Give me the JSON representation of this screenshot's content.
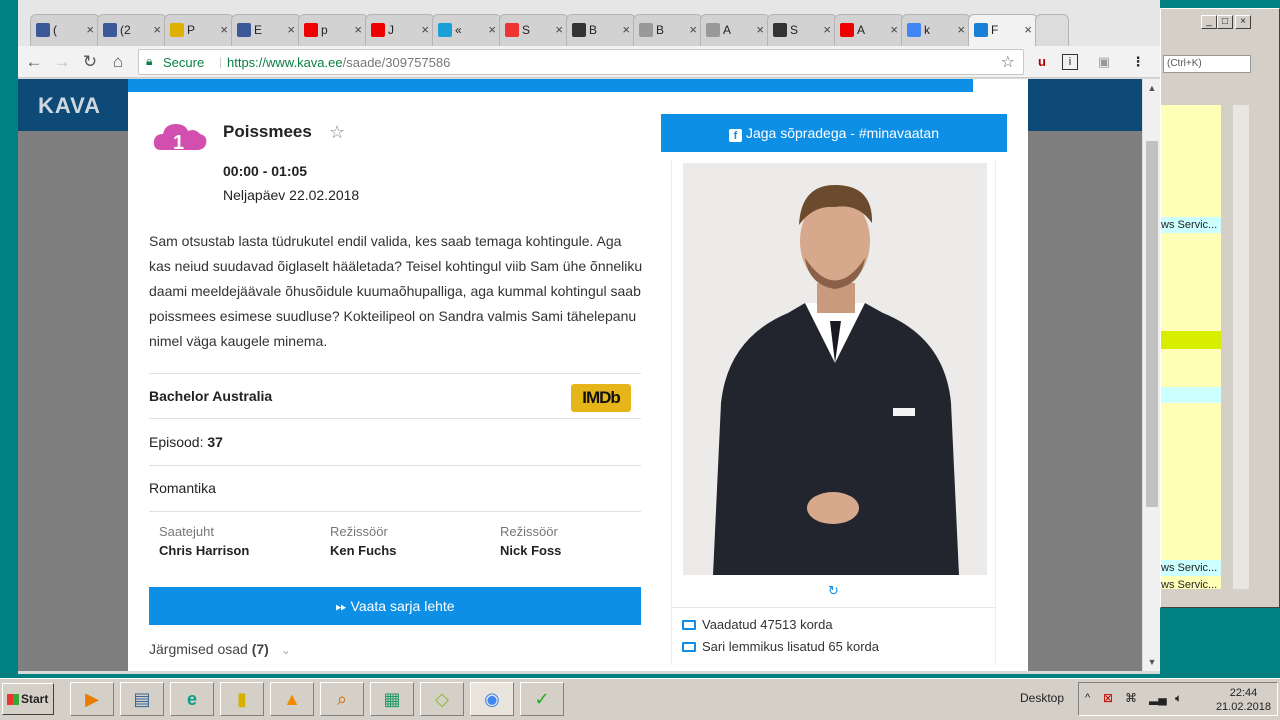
{
  "browser": {
    "tabs": [
      {
        "favicon": "facebook-icon",
        "label": "(",
        "color": "#3b5998"
      },
      {
        "favicon": "facebook-icon",
        "label": "(2",
        "color": "#3b5998"
      },
      {
        "favicon": "sun-icon",
        "label": "P",
        "color": "#e0b000"
      },
      {
        "favicon": "facebook-icon",
        "label": "E",
        "color": "#3b5998"
      },
      {
        "favicon": "youtube-icon",
        "label": "p",
        "color": "#e00"
      },
      {
        "favicon": "youtube-icon",
        "label": "J",
        "color": "#e00"
      },
      {
        "favicon": "pm-icon",
        "label": "«",
        "color": "#1ca0d8"
      },
      {
        "favicon": "star-icon",
        "label": "S",
        "color": "#e33"
      },
      {
        "favicon": "tv-icon",
        "label": "B",
        "color": "#333"
      },
      {
        "favicon": "document-icon",
        "label": "B",
        "color": "#999"
      },
      {
        "favicon": "document-icon",
        "label": "A",
        "color": "#999"
      },
      {
        "favicon": "tv-icon",
        "label": "S",
        "color": "#333"
      },
      {
        "favicon": "youtube-icon",
        "label": "A",
        "color": "#e00"
      },
      {
        "favicon": "google-icon",
        "label": "k",
        "color": "#4285f4"
      },
      {
        "favicon": "tvkava-icon",
        "label": "F",
        "color": "#1a7fd6"
      }
    ],
    "security_label": "Secure",
    "url_host": "https://www.kava.ee",
    "url_path": "/saade/309757586"
  },
  "site": {
    "logo": "KAVA"
  },
  "program": {
    "title": "Poissmees",
    "time": "00:00 - 01:05",
    "date": "Neljapäev 22.02.2018",
    "description": "Sam otsustab lasta tüdrukutel endil valida, kes saab temaga kohtingule. Aga kas neiud suudavad õiglaselt hääletada? Teisel kohtingul viib Sam ühe õnneliku daami meeldejäävale õhusõidule kuumaõhupalliga, aga kummal kohtingul saab poissmees esimese suudluse? Kokteilipeol on Sandra valmis Sami tähelepanu nimel väga kaugele minema.",
    "original_title": "Bachelor Australia",
    "imdb_label": "IMDb",
    "episode_label": "Episood:",
    "episode_number": "37",
    "genre": "Romantika",
    "crew": [
      {
        "role": "Saatejuht",
        "name": "Chris Harrison"
      },
      {
        "role": "Režissöör",
        "name": "Ken Fuchs"
      },
      {
        "role": "Režissöör",
        "name": "Nick Foss"
      }
    ],
    "series_button": "Vaata sarja lehte",
    "next_label": "Järgmised osad",
    "next_count": "(7)",
    "share_button": "Jaga sõpradega - #minavaatan",
    "stats": {
      "views": "Vaadatud 47513 korda",
      "favorites": "Sari lemmikus lisatud 65 korda"
    }
  },
  "background_window": {
    "search_placeholder": "(Ctrl+K)",
    "rows": [
      "ws Servic...",
      "ws Servic...",
      "ws Servic..."
    ]
  },
  "taskbar": {
    "start_label": "Start",
    "desktop_label": "Desktop",
    "time": "22:44",
    "date": "21.02.2018"
  }
}
